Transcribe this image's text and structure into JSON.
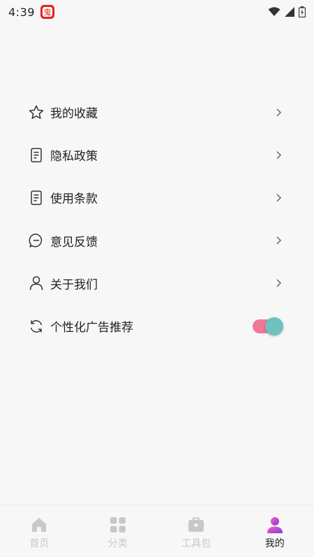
{
  "status_bar": {
    "time": "4:39",
    "app_badge_text": "鬼"
  },
  "menu": {
    "items": [
      {
        "label": "我的收藏",
        "icon": "star-icon"
      },
      {
        "label": "隐私政策",
        "icon": "document-icon"
      },
      {
        "label": "使用条款",
        "icon": "document-icon"
      },
      {
        "label": "意见反馈",
        "icon": "chat-bubble-icon"
      },
      {
        "label": "关于我们",
        "icon": "person-icon"
      }
    ],
    "toggle_item": {
      "label": "个性化广告推荐",
      "icon": "refresh-icon",
      "enabled": true
    }
  },
  "tab_bar": {
    "tabs": [
      {
        "label": "首页",
        "icon": "home-icon",
        "active": false
      },
      {
        "label": "分类",
        "icon": "grid-icon",
        "active": false
      },
      {
        "label": "工具包",
        "icon": "toolbox-icon",
        "active": false
      },
      {
        "label": "我的",
        "icon": "profile-icon",
        "active": true
      }
    ]
  },
  "colors": {
    "background": "#f7f7f7",
    "toggle_track": "#f07896",
    "toggle_knob": "#6fc1c0",
    "active_tab_gradient_start": "#ff5fa8",
    "active_tab_gradient_end": "#7b3cf0",
    "inactive_tab": "#c8c8c8"
  }
}
